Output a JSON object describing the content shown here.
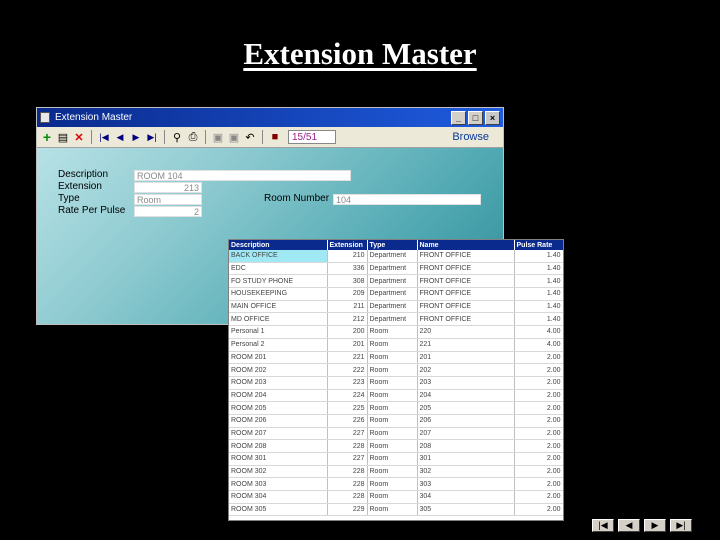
{
  "slide": {
    "title": "Extension Master"
  },
  "window": {
    "title": "Extension Master",
    "record_indicator": "15/51",
    "mode": "Browse",
    "controls": {
      "minimize": "_",
      "maximize": "□",
      "close": "×"
    }
  },
  "toolbar": {
    "icons": [
      "add-icon",
      "copy-icon",
      "delete-icon",
      "first-record-icon",
      "previous-record-icon",
      "next-record-icon",
      "last-record-icon",
      "find-icon",
      "print-icon",
      "save-icon",
      "cancel-save-icon",
      "undo-icon",
      "exit-icon"
    ]
  },
  "form": {
    "description_label": "Description",
    "description_value": "ROOM 104",
    "extension_label": "Extension",
    "extension_value": "213",
    "type_label": "Type",
    "type_value": "Room",
    "room_number_label": "Room Number",
    "room_number_value": "104",
    "rate_label": "Rate Per Pulse",
    "rate_value": "2"
  },
  "grid": {
    "columns": [
      "Description",
      "Extension",
      "Type",
      "Name",
      "Pulse Rate"
    ],
    "rows": [
      [
        "BACK OFFICE",
        "210",
        "Department",
        "FRONT OFFICE",
        "1.40"
      ],
      [
        "EDC",
        "336",
        "Department",
        "FRONT OFFICE",
        "1.40"
      ],
      [
        "FO STUDY PHONE",
        "308",
        "Department",
        "FRONT OFFICE",
        "1.40"
      ],
      [
        "HOUSEKEEPING",
        "209",
        "Department",
        "FRONT OFFICE",
        "1.40"
      ],
      [
        "MAIN OFFICE",
        "211",
        "Department",
        "FRONT OFFICE",
        "1.40"
      ],
      [
        "MD OFFICE",
        "212",
        "Department",
        "FRONT OFFICE",
        "1.40"
      ],
      [
        "Personal 1",
        "200",
        "Room",
        "220",
        "4.00"
      ],
      [
        "Personal 2",
        "201",
        "Room",
        "221",
        "4.00"
      ],
      [
        "ROOM 201",
        "221",
        "Room",
        "201",
        "2.00"
      ],
      [
        "ROOM 202",
        "222",
        "Room",
        "202",
        "2.00"
      ],
      [
        "ROOM 203",
        "223",
        "Room",
        "203",
        "2.00"
      ],
      [
        "ROOM 204",
        "224",
        "Room",
        "204",
        "2.00"
      ],
      [
        "ROOM 205",
        "225",
        "Room",
        "205",
        "2.00"
      ],
      [
        "ROOM 206",
        "226",
        "Room",
        "206",
        "2.00"
      ],
      [
        "ROOM 207",
        "227",
        "Room",
        "207",
        "2.00"
      ],
      [
        "ROOM 208",
        "228",
        "Room",
        "208",
        "2.00"
      ],
      [
        "ROOM 301",
        "227",
        "Room",
        "301",
        "2.00"
      ],
      [
        "ROOM 302",
        "228",
        "Room",
        "302",
        "2.00"
      ],
      [
        "ROOM 303",
        "228",
        "Room",
        "303",
        "2.00"
      ],
      [
        "ROOM 304",
        "228",
        "Room",
        "304",
        "2.00"
      ],
      [
        "ROOM 305",
        "229",
        "Room",
        "305",
        "2.00"
      ]
    ]
  },
  "slide_nav": [
    "first-slide-icon",
    "previous-slide-icon",
    "next-slide-icon",
    "last-slide-icon"
  ]
}
